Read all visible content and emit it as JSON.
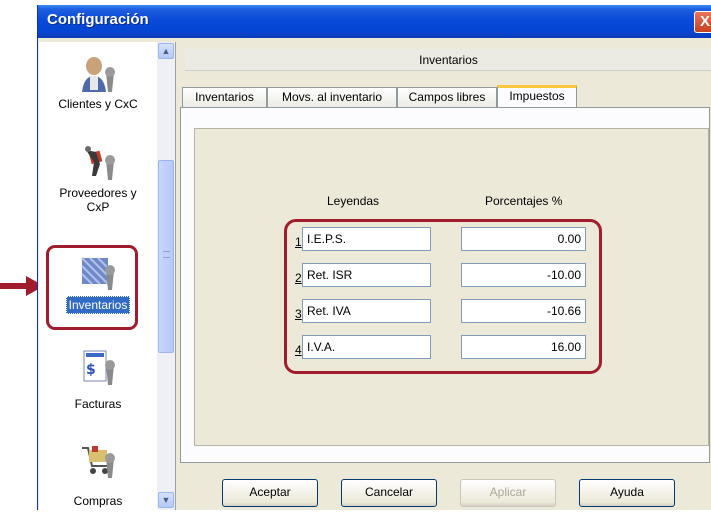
{
  "window": {
    "title": "Configuración",
    "close_label": "X"
  },
  "sidebar": {
    "items": [
      {
        "label": "Clientes y CxC",
        "icon": "clients-wrench-icon"
      },
      {
        "label": "Proveedores y CxP",
        "icon": "suppliers-wrench-icon"
      },
      {
        "label": "Inventarios",
        "icon": "inventory-wrench-icon",
        "selected": true
      },
      {
        "label": "Facturas",
        "icon": "invoice-wrench-icon"
      },
      {
        "label": "Compras",
        "icon": "purchases-wrench-icon"
      }
    ]
  },
  "main": {
    "header": "Inventarios",
    "tabs": [
      "Inventarios",
      "Movs. al inventario",
      "Campos libres",
      "Impuestos"
    ],
    "active_tab": "Impuestos",
    "columns": {
      "legends": "Leyendas",
      "percentages": "Porcentajes %"
    },
    "taxes": [
      {
        "num": "1",
        "legend": "I.E.P.S.",
        "percent": "0.00"
      },
      {
        "num": "2",
        "legend": "Ret. ISR",
        "percent": "-10.00"
      },
      {
        "num": "3",
        "legend": "Ret. IVA",
        "percent": "-10.66"
      },
      {
        "num": "4",
        "legend": "I.V.A.",
        "percent": "16.00"
      }
    ]
  },
  "buttons": {
    "accept": "Aceptar",
    "cancel": "Cancelar",
    "apply": "Aplicar",
    "help": "Ayuda"
  },
  "colors": {
    "highlight": "#a11c2d",
    "titlebar": "#0a4ad8",
    "selection": "#316ac5"
  }
}
